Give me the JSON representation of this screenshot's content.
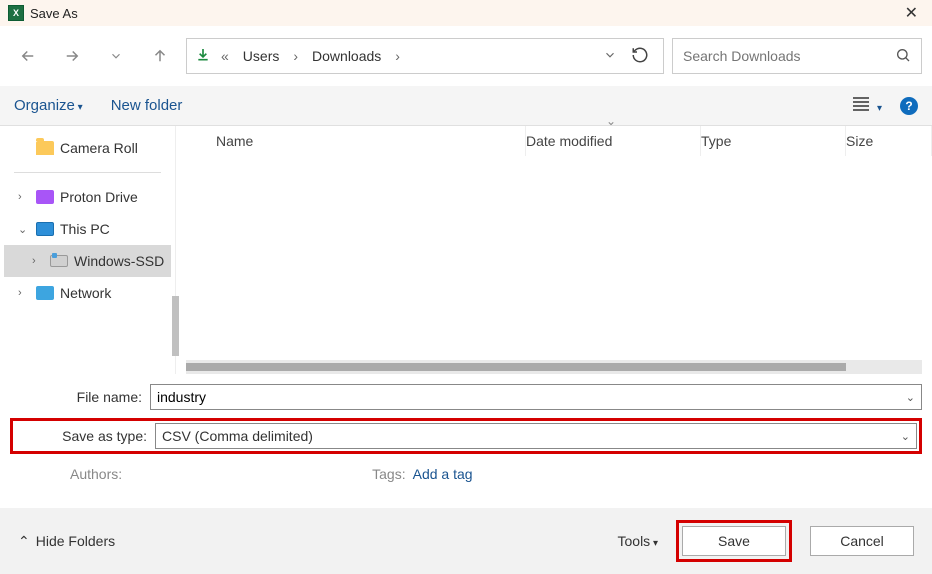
{
  "titlebar": {
    "title": "Save As"
  },
  "breadcrumbs": {
    "prefix": "«",
    "items": [
      "Users",
      "Downloads"
    ]
  },
  "search": {
    "placeholder": "Search Downloads"
  },
  "toolbar": {
    "organize": "Organize",
    "new_folder": "New folder"
  },
  "sidebar": {
    "camera_roll": "Camera Roll",
    "proton": "Proton Drive",
    "this_pc": "This PC",
    "drive": "Windows-SSD",
    "network": "Network"
  },
  "columns": {
    "name": "Name",
    "date": "Date modified",
    "type": "Type",
    "size": "Size"
  },
  "form": {
    "filename_label": "File name:",
    "filename_value": "industry",
    "type_label": "Save as type:",
    "type_value": "CSV (Comma delimited)",
    "authors_label": "Authors:",
    "tags_label": "Tags:",
    "tags_value": "Add a tag"
  },
  "footer": {
    "hide_folders": "Hide Folders",
    "tools": "Tools",
    "save": "Save",
    "cancel": "Cancel"
  }
}
